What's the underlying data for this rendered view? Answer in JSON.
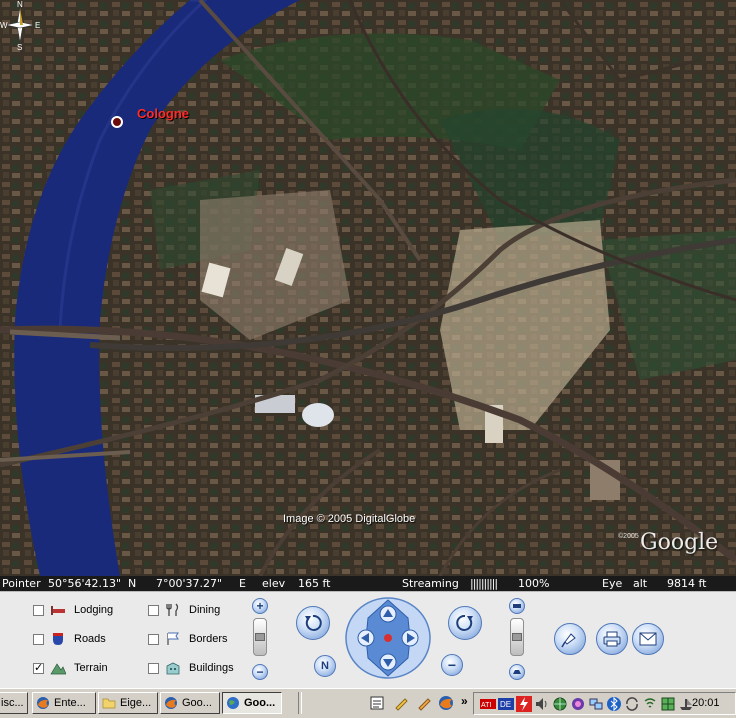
{
  "map": {
    "place_label": "Cologne",
    "credit": "Image © 2005 DigitalGlobe",
    "logo_year": "©2005",
    "logo": "Google",
    "compass": {
      "n": "N",
      "s": "S",
      "e": "E",
      "w": "W"
    }
  },
  "status": {
    "pointer_label": "Pointer",
    "pointer_lat": "50°56'42.13\"",
    "lat_hemi": "N",
    "pointer_lon": "7°00'37.27\"",
    "lon_hemi": "E",
    "elev_label": "elev",
    "elev_value": "165 ft",
    "streaming_label": "Streaming",
    "streaming_bar": "||||||||||",
    "streaming_value": "100%",
    "eye_label": "Eye",
    "alt_label": "alt",
    "alt_value": "9814 ft"
  },
  "layers": [
    {
      "label": "Lodging",
      "checked": false,
      "icon": "bed-icon"
    },
    {
      "label": "Roads",
      "checked": false,
      "icon": "road-shield-icon"
    },
    {
      "label": "Terrain",
      "checked": true,
      "icon": "mountain-icon"
    },
    {
      "label": "Dining",
      "checked": false,
      "icon": "fork-knife-icon"
    },
    {
      "label": "Borders",
      "checked": false,
      "icon": "flag-icon"
    },
    {
      "label": "Buildings",
      "checked": false,
      "icon": "building-icon"
    }
  ],
  "nav": {
    "north_label": "N",
    "check_mark": "✓"
  },
  "taskbar": {
    "tasks": [
      "isc...",
      "Ente...",
      "Eige...",
      "Goo...",
      "Goo..."
    ],
    "chevron": "»",
    "clock": "20:01"
  },
  "colors": {
    "place_label": "#ff2a2a",
    "river": "#1a2a7a",
    "panel": "#eaeaea"
  }
}
